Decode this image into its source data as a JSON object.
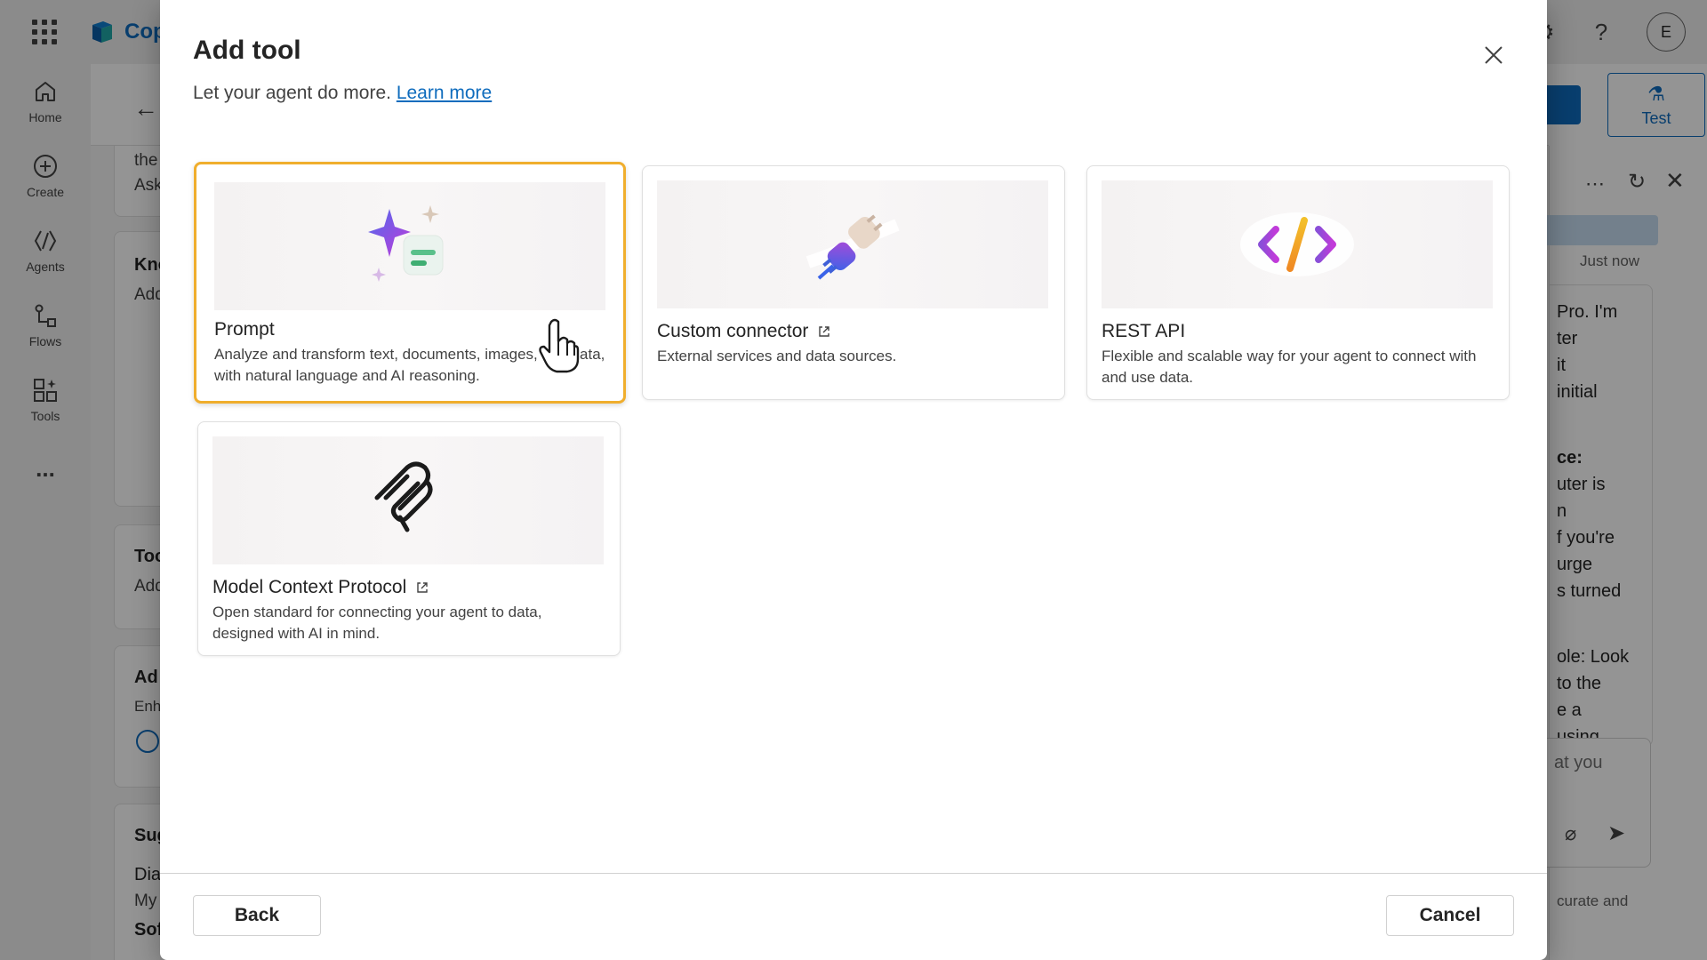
{
  "app": {
    "brand_name": "Cop",
    "avatar_initial": "E",
    "accent_color": "#0f6cbd"
  },
  "left_nav": {
    "items": [
      {
        "label": "Home",
        "icon": "home-icon"
      },
      {
        "label": "Create",
        "icon": "plus-circle-icon"
      },
      {
        "label": "Agents",
        "icon": "agents-icon"
      },
      {
        "label": "Flows",
        "icon": "flows-icon"
      },
      {
        "label": "Tools",
        "icon": "tools-icon"
      }
    ],
    "more_label": "..."
  },
  "background": {
    "card1_lines": [
      "the",
      "Ask"
    ],
    "card2_title": "Kno",
    "card2_sub": "Add",
    "card3_title": "Too",
    "card3_sub": "Add",
    "card4_title": "Ad",
    "card4_sub": "Enh",
    "card5_title": "Sug",
    "card5_item1": "Dia",
    "card5_item2": "My",
    "card5_item3": "Sof",
    "test_button_label": "Test",
    "chat_timestamp": "Just now",
    "chat_lines": [
      "Pro. I'm",
      "ter",
      "it",
      "initial",
      "",
      "ce:",
      "uter is",
      "n",
      "f you're",
      "urge",
      "s turned",
      "",
      "ole: Look",
      "to the",
      "e a",
      "using"
    ],
    "chat_input_placeholder": "at you",
    "chat_disclaimer": "curate and"
  },
  "dialog": {
    "title": "Add tool",
    "subtitle": "Let your agent do more.",
    "learn_more": "Learn more",
    "close_icon": "close-icon",
    "tools": [
      {
        "name": "Prompt",
        "description": "Analyze and transform text, documents, images, and data, with natural language and AI reasoning.",
        "external": false,
        "selected": true,
        "icon": "prompt-sparkle-icon"
      },
      {
        "name": "Custom connector",
        "description": "External services and data sources.",
        "external": true,
        "selected": false,
        "icon": "plug-icon"
      },
      {
        "name": "REST API",
        "description": "Flexible and scalable way for your agent to connect with and use data.",
        "external": false,
        "selected": false,
        "icon": "code-icon"
      },
      {
        "name": "Model Context Protocol",
        "description": "Open standard for connecting your agent to data, designed with AI in mind.",
        "external": true,
        "selected": false,
        "icon": "mcp-icon"
      }
    ],
    "back_label": "Back",
    "cancel_label": "Cancel",
    "selected_border_color": "#f0ae2d"
  }
}
